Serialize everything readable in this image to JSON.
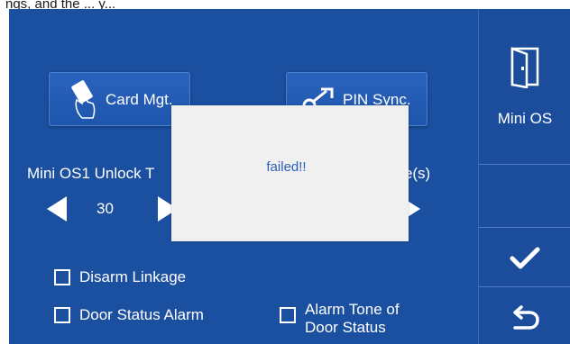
{
  "top_text": "ngs, and the ... y... ",
  "main": {
    "card_button_label": "Card Mgt.",
    "pin_button_label": "PIN Sync.",
    "unlock_time_label_1": "Mini OS1 Unlock T",
    "unlock_time_label_2": "ime(s)",
    "unlock_time_value_1": "30",
    "checkboxes": {
      "disarm_linkage": "Disarm Linkage",
      "door_status_alarm": "Door Status Alarm",
      "alarm_tone_line1": "Alarm Tone of",
      "alarm_tone_line2": "Door Status"
    }
  },
  "dialog": {
    "message": "failed!!"
  },
  "sidebar": {
    "mini_os_label": "Mini OS"
  },
  "colors": {
    "panel_bg": "#1b4fa0",
    "dialog_bg": "#f0f0f0",
    "dialog_text": "#2b62b8",
    "text": "#ffffff"
  },
  "icons": [
    "card-icon",
    "pin-sync-icon",
    "door-icon",
    "checkmark-icon",
    "back-icon"
  ]
}
